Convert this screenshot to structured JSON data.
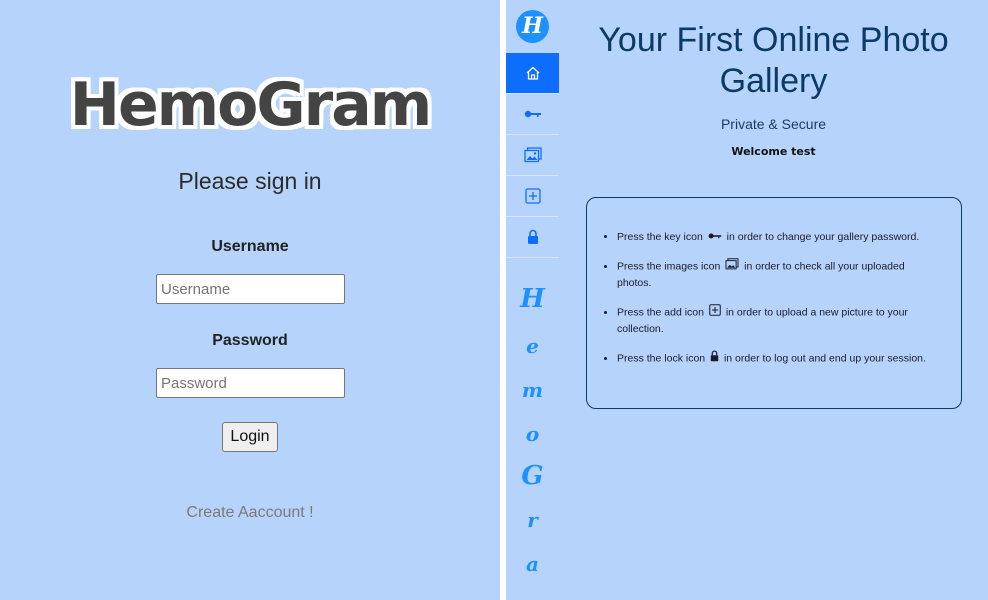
{
  "login": {
    "logo_text": "HemoGram",
    "title": "Please sign in",
    "username_label": "Username",
    "username_placeholder": "Username",
    "password_label": "Password",
    "password_placeholder": "Password",
    "login_button": "Login",
    "create_account_link": "Create Aaccount !"
  },
  "gallery": {
    "brand_letter": "H",
    "nav": [
      {
        "name": "home",
        "icon": "house-icon",
        "active": true
      },
      {
        "name": "change-password",
        "icon": "key-icon",
        "active": false
      },
      {
        "name": "images",
        "icon": "images-icon",
        "active": false
      },
      {
        "name": "add",
        "icon": "plus-square-icon",
        "active": false
      },
      {
        "name": "logout",
        "icon": "lock-icon",
        "active": false
      }
    ],
    "vertical_letters": [
      "H",
      "e",
      "m",
      "o",
      "G",
      "r",
      "a"
    ],
    "title": "Your First Online Photo Gallery",
    "subtitle": "Private & Secure",
    "welcome": "Welcome test",
    "instructions": [
      {
        "before": "Press the key icon",
        "after": "in order to change your gallery password.",
        "icon": "key-icon"
      },
      {
        "before": "Press the images icon",
        "after": "in order to check all your uploaded photos.",
        "icon": "images-icon"
      },
      {
        "before": "Press the add icon",
        "after": "in order to upload a new picture to your collection.",
        "icon": "plus-square-icon"
      },
      {
        "before": "Press the lock icon",
        "after": "in order to log out and end up your session.",
        "icon": "lock-icon"
      }
    ]
  },
  "colors": {
    "background": "#b6d4fb",
    "accent": "#0d6efd",
    "brand_blue": "#1e90ff",
    "title_dark": "#0b3a66"
  }
}
